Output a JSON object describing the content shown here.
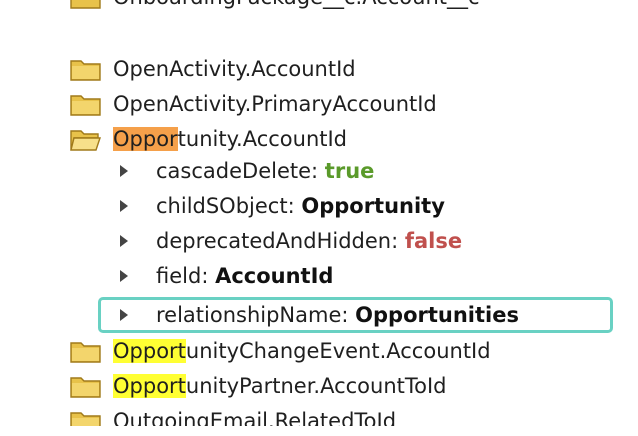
{
  "tree": {
    "top_partial": {
      "text": "OnboardingPackage__c.Account__c"
    },
    "rows": [
      {
        "type": "folder",
        "text": "OpenActivity.AccountId"
      },
      {
        "type": "folder",
        "text": "OpenActivity.PrimaryAccountId"
      },
      {
        "type": "folder-open",
        "hl": "Oppor",
        "rest": "tunity.AccountId"
      }
    ],
    "props": [
      {
        "key": "cascadeDelete",
        "value": "true"
      },
      {
        "key": "childSObject",
        "value": "Opportunity"
      },
      {
        "key": "deprecatedAndHidden",
        "value": "false"
      },
      {
        "key": "field",
        "value": "AccountId"
      },
      {
        "key": "relationshipName",
        "value": "Opportunities"
      }
    ],
    "after": [
      {
        "hl": "Opport",
        "rest": "unityChangeEvent.AccountId"
      },
      {
        "hl": "Opport",
        "rest": "unityPartner.AccountToId"
      }
    ],
    "bottom_partial": {
      "text": "OutgoingEmail.RelatedToId"
    },
    "colors": {
      "highlight_active": "#f5a04a",
      "highlight_match": "#ffff33",
      "selection_border": "#69d1c3",
      "value_true": "#5a9a2a",
      "value_false": "#c0504d"
    }
  }
}
